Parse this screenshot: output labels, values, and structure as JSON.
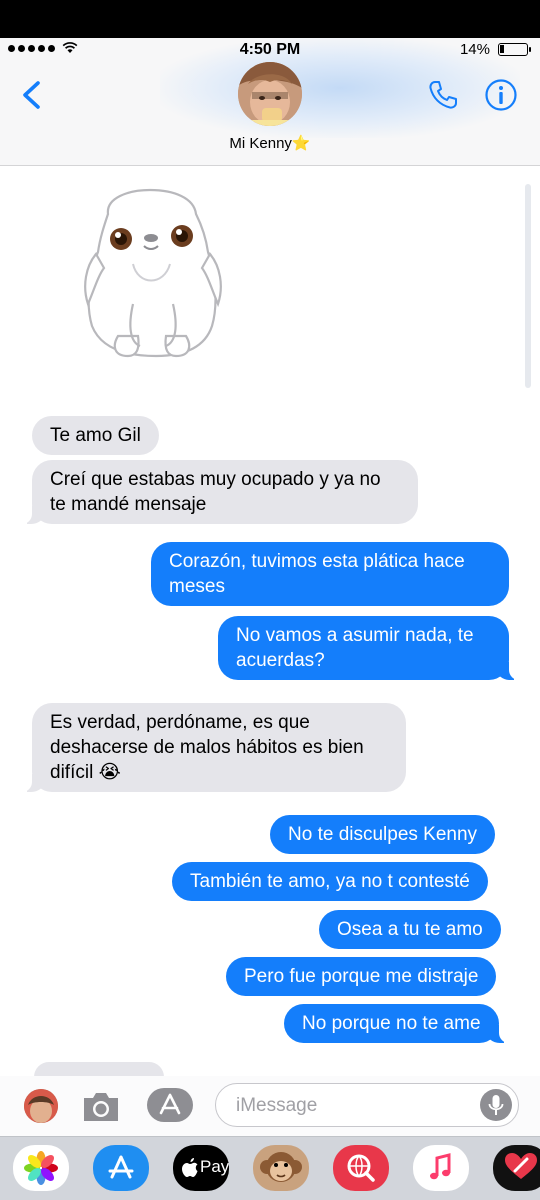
{
  "status_bar": {
    "time": "4:50 PM",
    "battery": "14%"
  },
  "header": {
    "contact_name": "Mi Kenny⭐"
  },
  "messages": [
    {
      "side": "in",
      "text": "Te amo Gil"
    },
    {
      "side": "in",
      "text": "Creí que estabas muy ocupado y ya no te mandé mensaje"
    },
    {
      "side": "out",
      "text": "Corazón, tuvimos esta plática hace meses"
    },
    {
      "side": "out",
      "text": "No vamos a asumir nada, te acuerdas?"
    },
    {
      "side": "in",
      "text": "Es verdad, perdóname, es que deshacerse de malos hábitos es bien difícil 😭"
    },
    {
      "side": "out",
      "text": "No te disculpes Kenny"
    },
    {
      "side": "out",
      "text": "También te amo, ya no t contesté"
    },
    {
      "side": "out",
      "text": "Osea a tu te amo"
    },
    {
      "side": "out",
      "text": "Pero fue porque me distraje"
    },
    {
      "side": "out",
      "text": "No porque no te ame"
    }
  ],
  "composer": {
    "placeholder": "iMessage"
  },
  "app_drawer": {
    "apps": [
      {
        "name": "photos-app-icon"
      },
      {
        "name": "app-store-icon"
      },
      {
        "name": "apple-pay-icon",
        "label": "Pay"
      },
      {
        "name": "animoji-monkey-icon"
      },
      {
        "name": "web-search-icon"
      },
      {
        "name": "music-icon"
      },
      {
        "name": "digital-touch-icon"
      }
    ]
  },
  "colors": {
    "outgoing": "#147efb",
    "incoming": "#e5e5ea",
    "accent": "#147efb"
  }
}
